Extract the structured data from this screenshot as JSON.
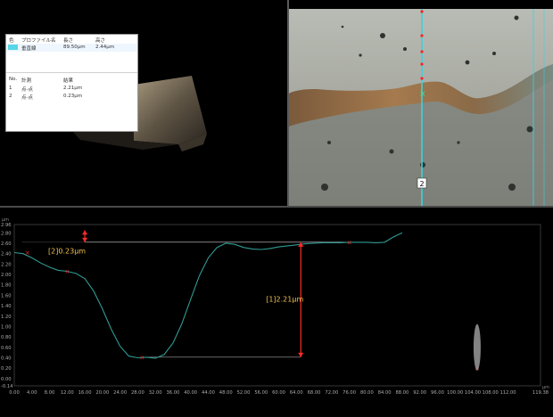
{
  "table": {
    "profile_headers": [
      "色",
      "プロファイル名",
      "長さ",
      "高さ"
    ],
    "profile_rows": [
      {
        "color": "#57d7e8",
        "name": "垂直線",
        "length": "89.50μm",
        "height": "2.44μm"
      }
    ],
    "measure_headers": [
      "No.",
      "計測",
      "結果"
    ],
    "measure_rows": [
      {
        "no": "1",
        "type": "点-点",
        "result": "2.21μm"
      },
      {
        "no": "2",
        "type": "点-点",
        "result": "0.23μm"
      }
    ]
  },
  "camera": {
    "marker_label": "2"
  },
  "colors": {
    "profile_line": "#2f9a92",
    "measure_arrow": "#ff2a2a",
    "label_text": "#f2c14e",
    "guide": "#cfcfcf",
    "camera_line": "#38d3df",
    "accent_red": "#ff2222"
  },
  "chart_data": {
    "type": "line",
    "title": "",
    "xlabel": "",
    "ylabel": "",
    "y_unit": "μm",
    "x_unit": "μm",
    "xlim": [
      0.0,
      119.38
    ],
    "ylim": [
      -0.14,
      2.96
    ],
    "x_ticks": [
      "0.00",
      "4.00",
      "8.00",
      "12.00",
      "16.00",
      "20.00",
      "24.00",
      "28.00",
      "32.00",
      "36.00",
      "40.00",
      "44.00",
      "48.00",
      "52.00",
      "56.00",
      "60.00",
      "64.00",
      "68.00",
      "72.00",
      "76.00",
      "80.00",
      "84.00",
      "88.00",
      "92.00",
      "96.00",
      "100.00",
      "104.00",
      "108.00",
      "112.00",
      "119.38"
    ],
    "y_ticks": [
      "2.96",
      "2.80",
      "2.60",
      "2.40",
      "2.20",
      "2.00",
      "1.80",
      "1.60",
      "1.40",
      "1.20",
      "1.00",
      "0.80",
      "0.60",
      "0.40",
      "0.20",
      "0.00",
      "-0.14"
    ],
    "series": [
      {
        "x": [
          0,
          2,
          4,
          6,
          8,
          10,
          12,
          14,
          16,
          18,
          20,
          22,
          24,
          26,
          28,
          30,
          32,
          34,
          36,
          38,
          40,
          42,
          44,
          46,
          48,
          50,
          52,
          54,
          56,
          58,
          60,
          62,
          64,
          66,
          68,
          70,
          72,
          74,
          76,
          78,
          80,
          82,
          84,
          86,
          88
        ],
        "y": [
          2.42,
          2.4,
          2.32,
          2.22,
          2.14,
          2.08,
          2.06,
          2.02,
          1.92,
          1.68,
          1.34,
          0.95,
          0.62,
          0.43,
          0.4,
          0.41,
          0.39,
          0.46,
          0.68,
          1.05,
          1.52,
          1.98,
          2.32,
          2.52,
          2.6,
          2.58,
          2.52,
          2.49,
          2.48,
          2.5,
          2.53,
          2.55,
          2.57,
          2.59,
          2.6,
          2.61,
          2.61,
          2.61,
          2.62,
          2.62,
          2.62,
          2.61,
          2.62,
          2.72,
          2.8
        ]
      }
    ],
    "markers": [
      {
        "x": 3.0,
        "y": 2.42
      },
      {
        "x": 12.0,
        "y": 2.06
      },
      {
        "x": 29.0,
        "y": 0.41
      },
      {
        "x": 76.0,
        "y": 2.62
      },
      {
        "x": 105.0,
        "y": 0.2
      }
    ],
    "measurements": [
      {
        "label": "[1]2.21μm",
        "x": 65.0,
        "y_low": 0.41,
        "y_high": 2.62
      },
      {
        "label": "[2]0.23μm",
        "x": 16.0,
        "y_low": 2.62,
        "y_high": 2.85
      }
    ],
    "slider_x": 105.0
  }
}
